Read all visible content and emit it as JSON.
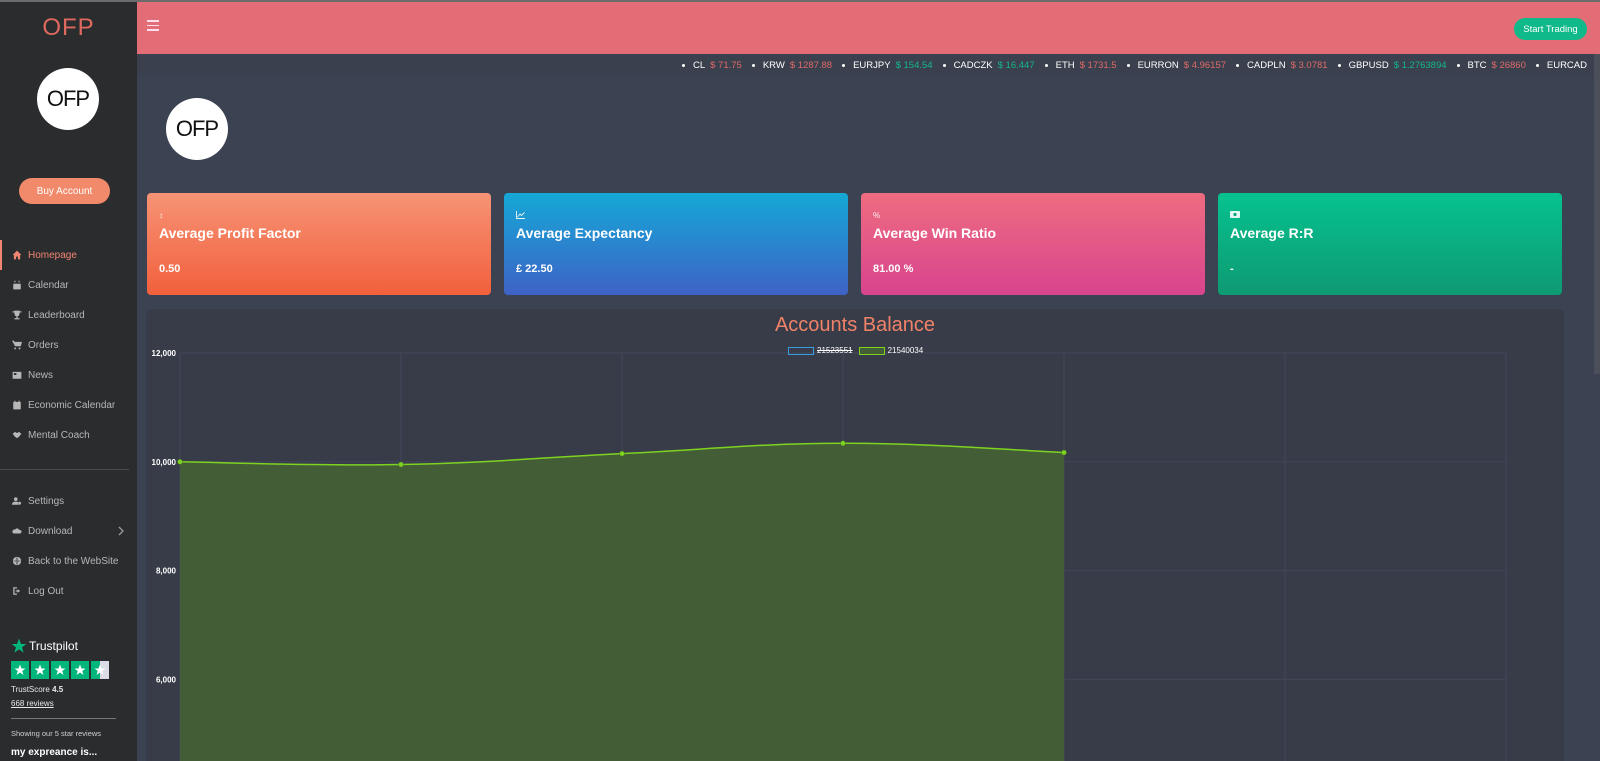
{
  "sidebar": {
    "brand": "OFP",
    "logo": "OFP",
    "buy_label": "Buy Account",
    "items": [
      {
        "label": "Homepage",
        "icon": "home-icon"
      },
      {
        "label": "Calendar",
        "icon": "calendar-icon"
      },
      {
        "label": "Leaderboard",
        "icon": "trophy-icon"
      },
      {
        "label": "Orders",
        "icon": "cart-icon"
      },
      {
        "label": "News",
        "icon": "newspaper-icon"
      },
      {
        "label": "Economic Calendar",
        "icon": "calendar-icon"
      },
      {
        "label": "Mental Coach",
        "icon": "handshake-icon"
      }
    ],
    "items2": [
      {
        "label": "Settings",
        "icon": "user-gear-icon"
      },
      {
        "label": "Download",
        "icon": "cloud-download-icon"
      },
      {
        "label": "Back to the WebSite",
        "icon": "globe-icon"
      },
      {
        "label": "Log Out",
        "icon": "logout-icon"
      }
    ]
  },
  "trustpilot": {
    "name": "Trustpilot",
    "score_label": "TrustScore",
    "score": "4.5",
    "reviews": "668 reviews",
    "showing": "Showing our 5 star reviews",
    "review_title": "my expreance is..."
  },
  "header": {
    "start_label": "Start Trading"
  },
  "ticker": [
    {
      "sym": "CL",
      "price": "$ 71.75",
      "dir": "down"
    },
    {
      "sym": "KRW",
      "price": "$ 1287.88",
      "dir": "down"
    },
    {
      "sym": "EURJPY",
      "price": "$ 154.54",
      "dir": "up"
    },
    {
      "sym": "CADCZK",
      "price": "$ 16.447",
      "dir": "up"
    },
    {
      "sym": "ETH",
      "price": "$ 1731.5",
      "dir": "down"
    },
    {
      "sym": "EURRON",
      "price": "$ 4.96157",
      "dir": "down"
    },
    {
      "sym": "CADPLN",
      "price": "$ 3.0781",
      "dir": "down"
    },
    {
      "sym": "GBPUSD",
      "price": "$ 1.2763894",
      "dir": "up"
    },
    {
      "sym": "BTC",
      "price": "$ 26860",
      "dir": "down"
    },
    {
      "sym": "EURCAD",
      "price": "",
      "dir": "up"
    }
  ],
  "main": {
    "logo": "OFP"
  },
  "cards": [
    {
      "title": "Average Profit Factor",
      "value": "0.50",
      "icon": "↕"
    },
    {
      "title": "Average Expectancy",
      "value": "£ 22.50",
      "icon": "📈"
    },
    {
      "title": "Average Win Ratio",
      "value": "81.00 %",
      "icon": "%"
    },
    {
      "title": "Average R:R",
      "value": "-",
      "icon": "▣"
    }
  ],
  "colors": {
    "header": "#e36d77",
    "accent": "#f28572",
    "green": "#10b98a",
    "line": "#7ed321",
    "fill": "#435d37"
  },
  "chart_data": {
    "type": "area",
    "title": "Accounts Balance",
    "ylim": [
      4500,
      12000
    ],
    "yticks": [
      12000,
      10000,
      8000,
      6000
    ],
    "ytick_labels": [
      "12,000",
      "10,000",
      "8,000",
      "6,000"
    ],
    "x_count": 7,
    "series": [
      {
        "name": "21523551",
        "hidden": true,
        "values": []
      },
      {
        "name": "21540034",
        "values": [
          10000,
          9950,
          10150,
          10340,
          10170
        ]
      }
    ]
  }
}
